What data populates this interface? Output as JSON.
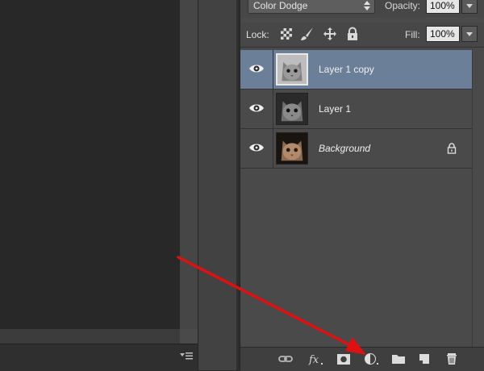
{
  "blend": {
    "mode": "Color Dodge"
  },
  "opacity": {
    "label": "Opacity:",
    "value": "100%"
  },
  "lock": {
    "label": "Lock:"
  },
  "fill": {
    "label": "Fill:",
    "value": "100%"
  },
  "layers": [
    {
      "name": "Layer 1 copy",
      "selected": true,
      "italic": false,
      "locked": false,
      "thumb": "cat-bw"
    },
    {
      "name": "Layer 1",
      "selected": false,
      "italic": false,
      "locked": false,
      "thumb": "cat-bw-dark"
    },
    {
      "name": "Background",
      "selected": false,
      "italic": true,
      "locked": true,
      "thumb": "cat-color"
    }
  ],
  "footer_icons": [
    "link-icon",
    "fx-icon",
    "mask-icon",
    "adjustment-icon",
    "folder-icon",
    "new-layer-icon",
    "trash-icon"
  ],
  "colors": {
    "selected_row": "#6b7f99",
    "annotation_arrow": "#e01010",
    "panel_bg": "#4a4a4a"
  }
}
